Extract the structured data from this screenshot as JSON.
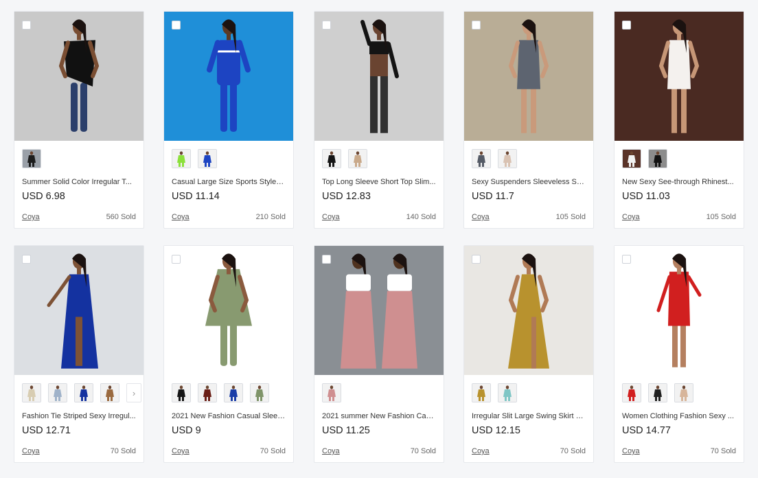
{
  "products": [
    {
      "title": "Summer Solid Color Irregular T...",
      "price": "USD 6.98",
      "seller": "Coya",
      "sold": "560 Sold",
      "image": {
        "bg": "#c9c9c9",
        "style": "top-jeans",
        "c1": "#111111",
        "c2": "#2b3f6b",
        "skin": "#7a4e33"
      },
      "swatches": [
        {
          "bg": "#9aa0a8",
          "c": "#1c1c1c"
        }
      ]
    },
    {
      "title": "Casual Large Size Sports Style T...",
      "price": "USD 11.14",
      "seller": "Coya",
      "sold": "210 Sold",
      "image": {
        "bg": "#1f8fd8",
        "style": "tracksuit",
        "c1": "#1d44c2",
        "c2": "#1d44c2",
        "skin": "#5b3a26"
      },
      "swatches": [
        {
          "bg": "#f2f2f2",
          "c": "#8be03a"
        },
        {
          "bg": "#f2f2f2",
          "c": "#1d44c2"
        }
      ]
    },
    {
      "title": "Top Long Sleeve Short Top Slim...",
      "price": "USD 12.83",
      "seller": "Coya",
      "sold": "140 Sold",
      "image": {
        "bg": "#cfcfcf",
        "style": "two-piece",
        "c1": "#141414",
        "c2": "#141414",
        "skin": "#6a4431"
      },
      "swatches": [
        {
          "bg": "#f2f2f2",
          "c": "#151515"
        },
        {
          "bg": "#f2f2f2",
          "c": "#c9a98a"
        }
      ]
    },
    {
      "title": "Sexy Suspenders Sleeveless She...",
      "price": "USD 11.7",
      "seller": "Coya",
      "sold": "105 Sold",
      "image": {
        "bg": "#b9ad96",
        "style": "mini",
        "c1": "#5d6470",
        "c2": "#5d6470",
        "skin": "#c99a7b"
      },
      "swatches": [
        {
          "bg": "#f2f2f2",
          "c": "#555b66"
        },
        {
          "bg": "#f2f2f2",
          "c": "#d9c2b2"
        }
      ]
    },
    {
      "title": "New Sexy See-through Rhinest...",
      "price": "USD 11.03",
      "seller": "Coya",
      "sold": "105 Sold",
      "image": {
        "bg": "#4a2a22",
        "style": "bodycon",
        "c1": "#f4f1ee",
        "c2": "#f4f1ee",
        "skin": "#c79777"
      },
      "swatches": [
        {
          "bg": "#5a3328",
          "c": "#f2f2f2"
        },
        {
          "bg": "#8c8c8c",
          "c": "#121212"
        }
      ]
    },
    {
      "title": "Fashion Tie Striped Sexy Irregul...",
      "price": "USD 12.71",
      "seller": "Coya",
      "sold": "70 Sold",
      "image": {
        "bg": "#dcdfe3",
        "style": "maxi-romper",
        "c1": "#1432a0",
        "c2": "#1432a0",
        "skin": "#7d5236"
      },
      "swatches": [
        {
          "bg": "#f2f2f2",
          "c": "#d8cdb2"
        },
        {
          "bg": "#f2f2f2",
          "c": "#9fb2c9"
        },
        {
          "bg": "#f2f2f2",
          "c": "#1432a0"
        },
        {
          "bg": "#f2f2f2",
          "c": "#9a6a3f"
        }
      ],
      "has_next": true
    },
    {
      "title": "2021 New Fashion Casual Sleev...",
      "price": "USD 9",
      "seller": "Coya",
      "sold": "70 Sold",
      "image": {
        "bg": "#ffffff",
        "style": "tunic-set",
        "c1": "#889a70",
        "c2": "#889a70",
        "skin": "#8a5a3e"
      },
      "swatches": [
        {
          "bg": "#f2f2f2",
          "c": "#161616"
        },
        {
          "bg": "#f2f2f2",
          "c": "#6a1e16"
        },
        {
          "bg": "#f2f2f2",
          "c": "#1b3ea8"
        },
        {
          "bg": "#f2f2f2",
          "c": "#7f9469"
        }
      ]
    },
    {
      "title": "2021 summer New Fashion Cas...",
      "price": "USD 11.25",
      "seller": "Coya",
      "sold": "70 Sold",
      "image": {
        "bg": "#8a8f94",
        "style": "wide-pants",
        "c1": "#ffffff",
        "c2": "#cf8f90",
        "skin": "#4f321f"
      },
      "swatches": [
        {
          "bg": "#f2f2f2",
          "c": "#cf8f90"
        }
      ]
    },
    {
      "title": "Irregular Slit Large Swing Skirt S...",
      "price": "USD 12.15",
      "seller": "Coya",
      "sold": "70 Sold",
      "image": {
        "bg": "#e9e7e3",
        "style": "gown",
        "c1": "#b8922e",
        "c2": "#b8922e",
        "skin": "#b07a55"
      },
      "swatches": [
        {
          "bg": "#f2f2f2",
          "c": "#b8922e"
        },
        {
          "bg": "#f2f2f2",
          "c": "#7fc6c5"
        }
      ]
    },
    {
      "title": "Women Clothing Fashion Sexy ...",
      "price": "USD 14.77",
      "seller": "Coya",
      "sold": "70 Sold",
      "image": {
        "bg": "#ffffff",
        "style": "fringe",
        "c1": "#d11f1f",
        "c2": "#d11f1f",
        "skin": "#b58060"
      },
      "swatches": [
        {
          "bg": "#f2f2f2",
          "c": "#d11f1f"
        },
        {
          "bg": "#f2f2f2",
          "c": "#202020"
        },
        {
          "bg": "#f2f2f2",
          "c": "#d7b59a"
        }
      ]
    }
  ]
}
